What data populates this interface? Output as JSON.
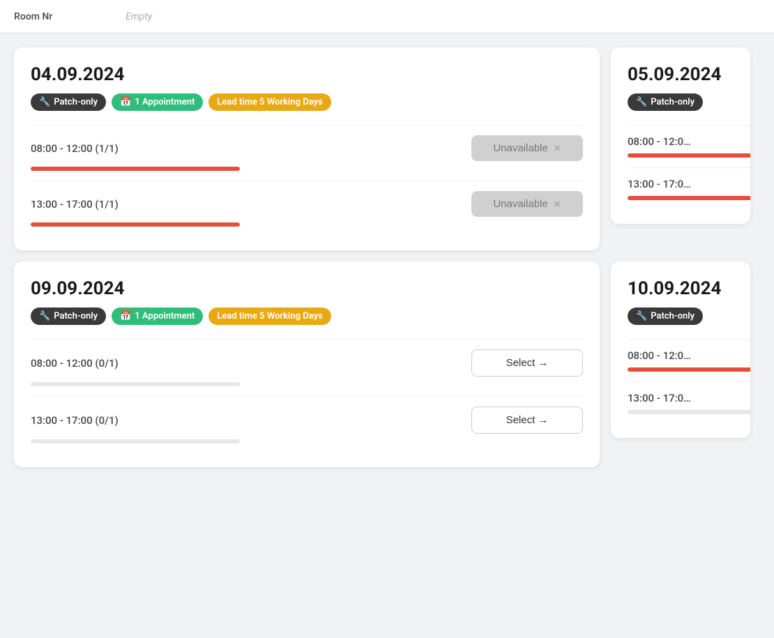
{
  "topbar": {
    "room_nr_label": "Room Nr",
    "room_nr_value": "Empty"
  },
  "cards": [
    {
      "date": "04.09.2024",
      "badges": [
        {
          "type": "dark",
          "icon": "wrench",
          "label": "Patch-only"
        },
        {
          "type": "green",
          "icon": "calendar",
          "label": "1 Appointment"
        },
        {
          "type": "yellow",
          "icon": "",
          "label": "Lead time 5 Working Days"
        }
      ],
      "slots": [
        {
          "time": "08:00 - 12:00 (1/1)",
          "status": "unavailable",
          "btn_label": "Unavailable",
          "progress": 100
        },
        {
          "time": "13:00 - 17:00 (1/1)",
          "status": "unavailable",
          "btn_label": "Unavailable",
          "progress": 100
        }
      ]
    },
    {
      "date": "09.09.2024",
      "badges": [
        {
          "type": "dark",
          "icon": "wrench",
          "label": "Patch-only"
        },
        {
          "type": "green",
          "icon": "calendar",
          "label": "1 Appointment"
        },
        {
          "type": "yellow",
          "icon": "",
          "label": "Lead time 5 Working Days"
        }
      ],
      "slots": [
        {
          "time": "08:00 - 12:00 (0/1)",
          "status": "select",
          "btn_label": "Select →",
          "progress": 0
        },
        {
          "time": "13:00 - 17:00 (0/1)",
          "status": "select",
          "btn_label": "Select →",
          "progress": 0
        }
      ]
    }
  ],
  "partial_cards": [
    {
      "date": "05.09.2024",
      "badges": [
        {
          "type": "dark",
          "icon": "wrench",
          "label": "Patch-only"
        }
      ],
      "slots": [
        {
          "time": "08:00 - 12:0…",
          "progress": 100
        },
        {
          "time": "13:00 - 17:0…",
          "progress": 100
        }
      ]
    },
    {
      "date": "10.09.2024",
      "badges": [
        {
          "type": "dark",
          "icon": "wrench",
          "label": "Patch-only"
        }
      ],
      "slots": [
        {
          "time": "08:00 - 12:0…",
          "progress": 100
        },
        {
          "time": "13:00 - 17:0…",
          "progress": 0
        }
      ]
    }
  ],
  "icons": {
    "wrench": "🔧",
    "calendar": "📅",
    "close": "✕",
    "arrow": "→"
  }
}
